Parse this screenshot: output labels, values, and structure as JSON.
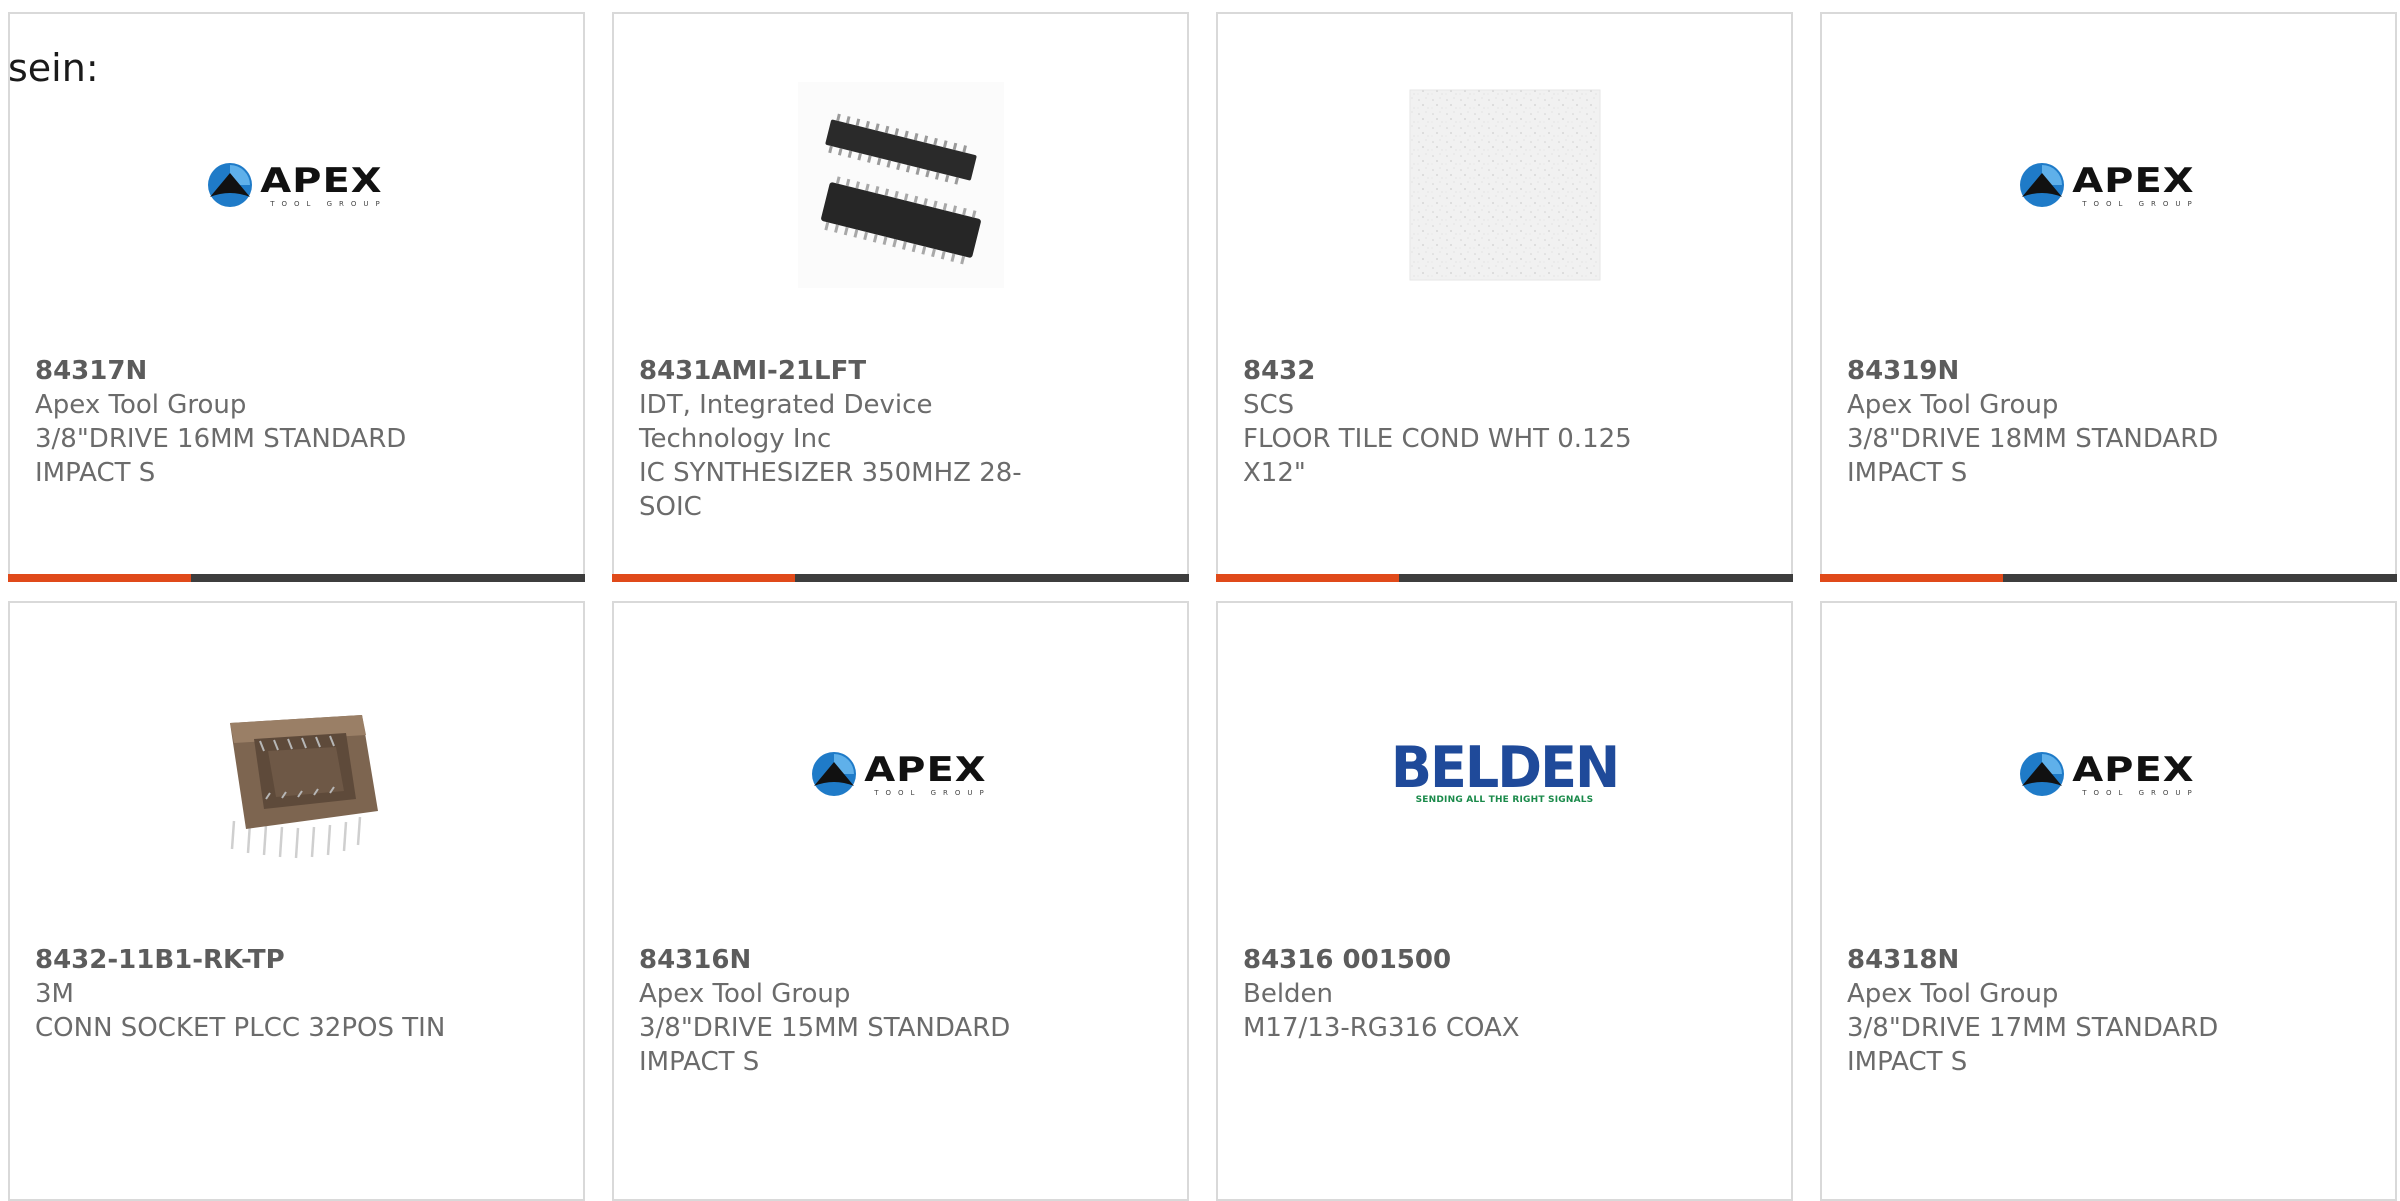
{
  "page": {
    "heading": "sein:",
    "colors": {
      "accent": "#e04a1a",
      "bar": "#3d3d3d",
      "border": "#d9d9d9",
      "text": "#6b6b6b"
    }
  },
  "products": [
    {
      "part_number": "84317N",
      "manufacturer": "Apex Tool Group",
      "description": "3/8\"DRIVE 16MM STANDARD IMPACT S",
      "image": "apex-logo"
    },
    {
      "part_number": "8431AMI-21LFT",
      "manufacturer": "IDT, Integrated Device Technology Inc",
      "description": "IC SYNTHESIZER 350MHZ 28-SOIC",
      "image": "soic-chip"
    },
    {
      "part_number": "8432",
      "manufacturer": "SCS",
      "description": "FLOOR TILE COND WHT 0.125 X12\"",
      "image": "floor-tile"
    },
    {
      "part_number": "84319N",
      "manufacturer": "Apex Tool Group",
      "description": "3/8\"DRIVE 18MM STANDARD IMPACT S",
      "image": "apex-logo"
    },
    {
      "part_number": "8432-11B1-RK-TP",
      "manufacturer": "3M",
      "description": "CONN SOCKET PLCC 32POS TIN",
      "image": "plcc-socket"
    },
    {
      "part_number": "84316N",
      "manufacturer": "Apex Tool Group",
      "description": "3/8\"DRIVE 15MM STANDARD IMPACT S",
      "image": "apex-logo"
    },
    {
      "part_number": "84316 001500",
      "manufacturer": "Belden",
      "description": "M17/13-RG316 COAX",
      "image": "belden-logo"
    },
    {
      "part_number": "84318N",
      "manufacturer": "Apex Tool Group",
      "description": "3/8\"DRIVE 17MM STANDARD IMPACT S",
      "image": "apex-logo"
    }
  ],
  "logos": {
    "apex_word": "APEX",
    "apex_sub": "TOOL GROUP",
    "belden_word": "BELDEN",
    "belden_tag": "SENDING ALL THE RIGHT SIGNALS"
  }
}
